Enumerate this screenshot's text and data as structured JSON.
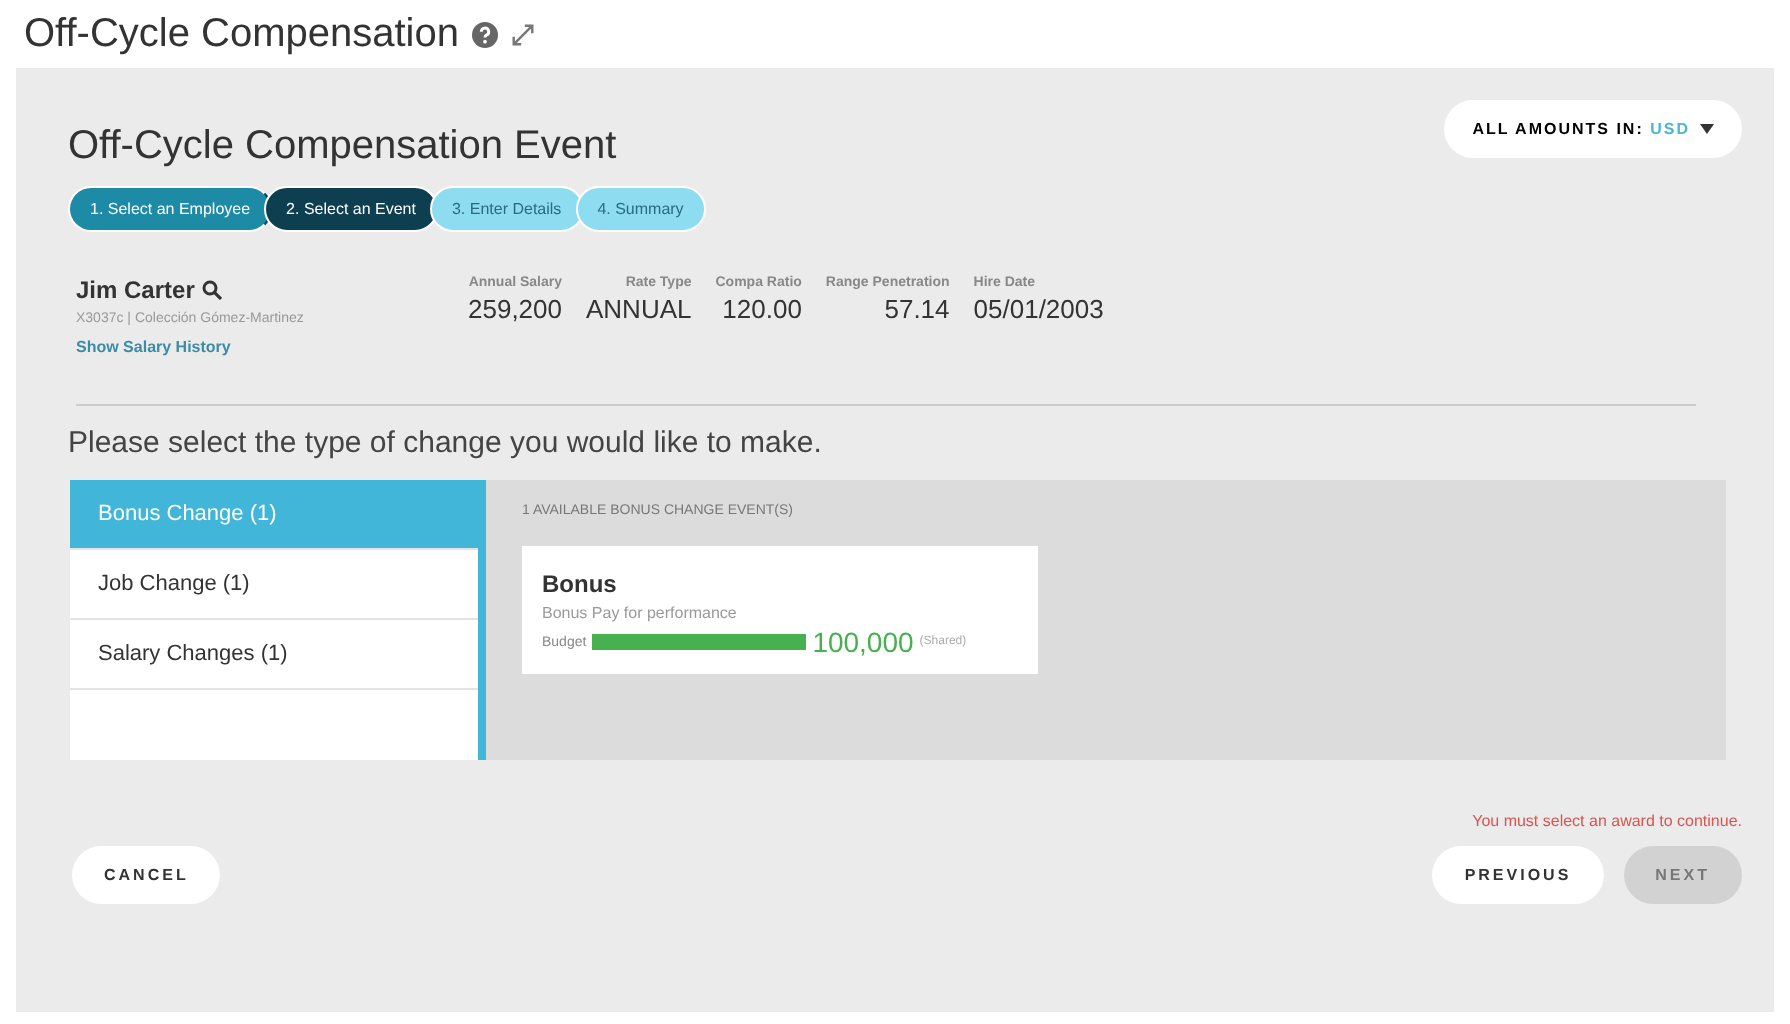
{
  "page_title": "Off-Cycle Compensation",
  "event": {
    "title": "Off-Cycle Compensation Event",
    "currency_label": "ALL AMOUNTS IN:",
    "currency": "USD"
  },
  "steps": [
    {
      "label": "1. Select an Employee",
      "completed": true,
      "selected": false
    },
    {
      "label": "2. Select an Event",
      "completed": false,
      "selected": true
    },
    {
      "label": "3. Enter Details",
      "completed": false,
      "selected": false
    },
    {
      "label": "4. Summary",
      "completed": false,
      "selected": false
    }
  ],
  "employee": {
    "name": "Jim Carter",
    "subtitle": "X3037c | Colección Gómez-Martinez",
    "link": "Show Salary History"
  },
  "stats": [
    {
      "label": "Annual Salary",
      "value": "259,200"
    },
    {
      "label": "Rate Type",
      "value": "ANNUAL"
    },
    {
      "label": "Compa Ratio",
      "value": "120.00"
    },
    {
      "label": "Range Penetration",
      "value": "57.14"
    },
    {
      "label": "Hire Date",
      "value": "05/01/2003"
    }
  ],
  "prompt": "Please select the type of change you would like to make.",
  "change_types": [
    {
      "label": "Bonus Change (1)",
      "selected": true
    },
    {
      "label": "Job Change (1)",
      "selected": false
    },
    {
      "label": "Salary Changes (1)",
      "selected": false
    }
  ],
  "events_heading": "1 AVAILABLE BONUS CHANGE EVENT(S)",
  "event_cards": [
    {
      "title": "Bonus",
      "description": "Bonus Pay for performance",
      "budget_label": "Budget",
      "level": 1,
      "amount": "100,000",
      "note": "(Shared)"
    }
  ],
  "error": "You must select an award to continue.",
  "buttons": {
    "cancel": "CANCEL",
    "previous": "PREVIOUS",
    "next": {
      "label": "NEXT",
      "disabled": true
    }
  }
}
